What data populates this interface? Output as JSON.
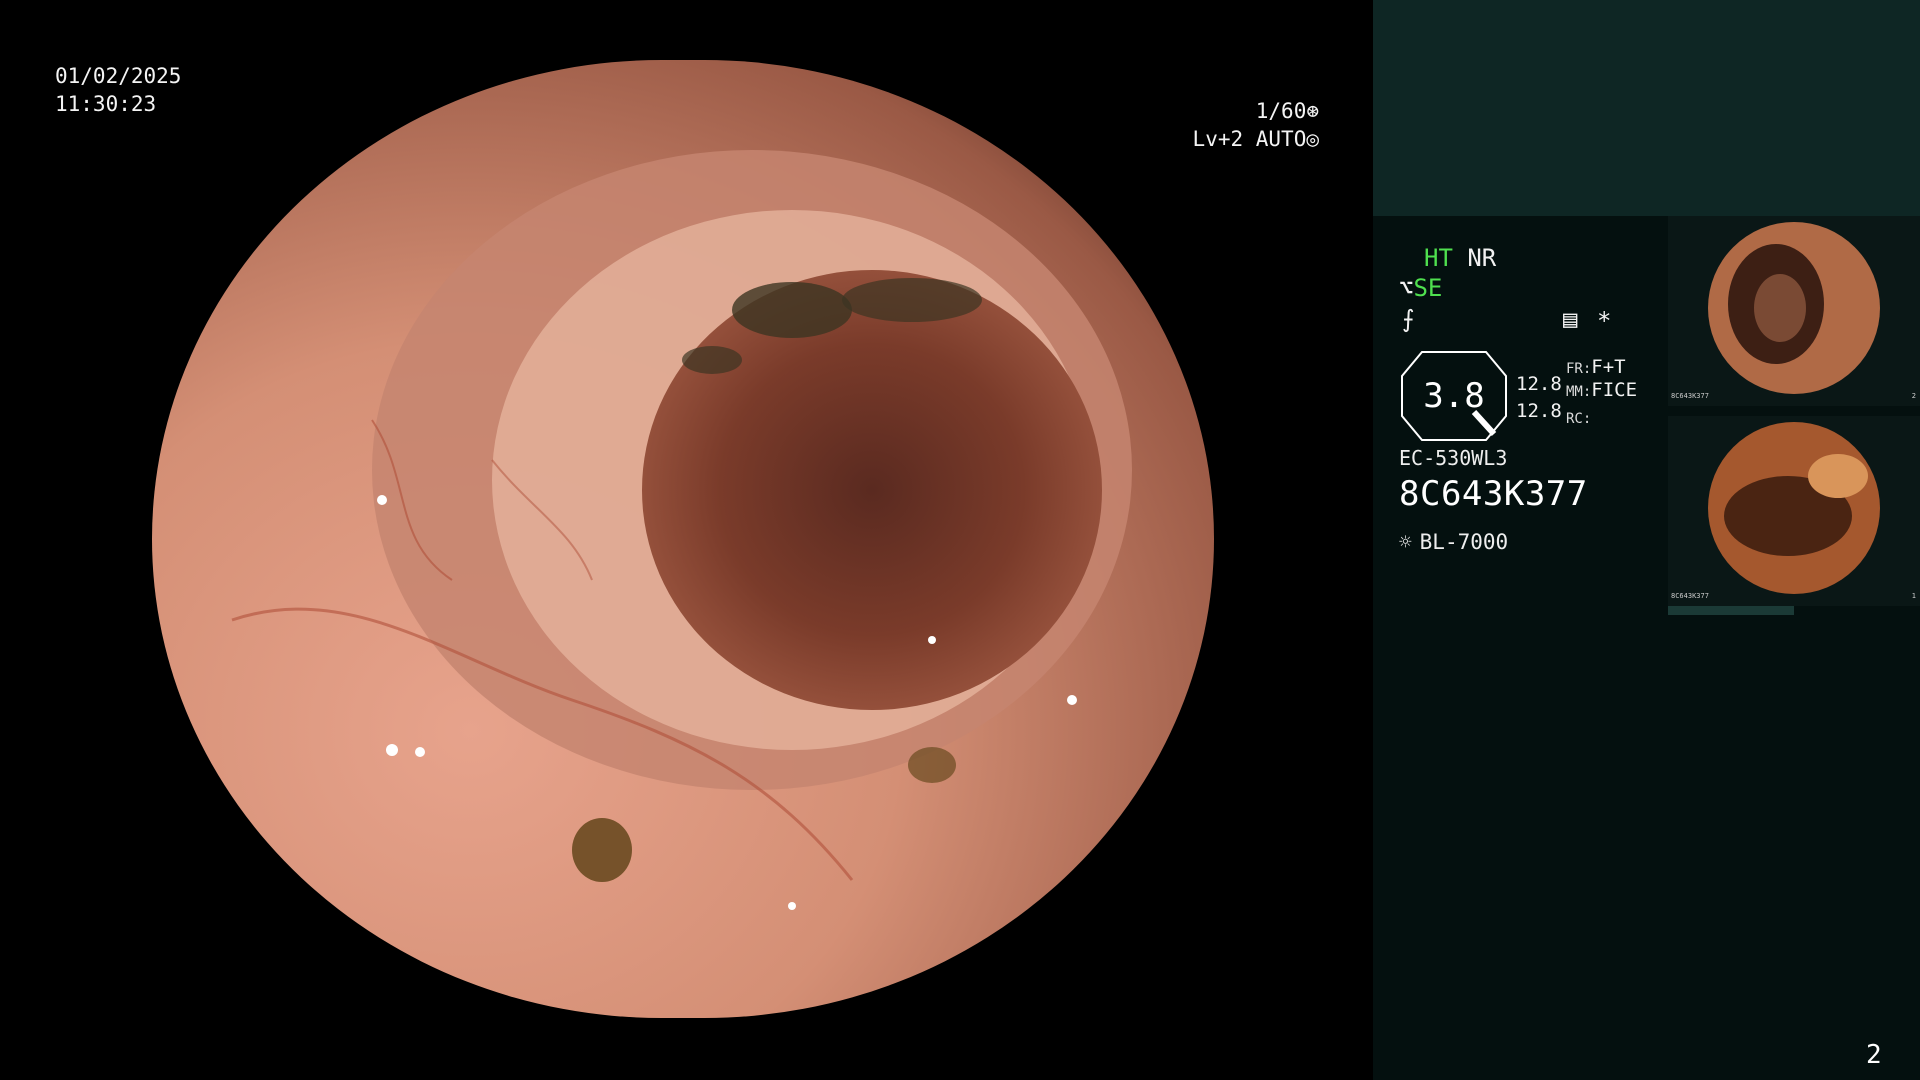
{
  "overlay": {
    "date": "01/02/2025",
    "time": "11:30:23",
    "shutter": "1/60",
    "shutter_icon": "aperture-icon",
    "exposure": "Lv+2 AUTO",
    "exposure_icon": "iris-icon"
  },
  "status": {
    "ht": "HT",
    "nr": "NR",
    "se": "SE",
    "se_icon": "structure-enhance-icon",
    "curve_icon": "tone-curve-icon",
    "menu_icon": "settings-panel-icon",
    "asterisk": "*",
    "zoom": "3.8",
    "val1": "12.8",
    "val2": "12.8",
    "fr_label": "FR:",
    "fr_value": "F+T",
    "mm_label": "MM:",
    "mm_value": "FICE",
    "rc_label": "RC:"
  },
  "device": {
    "model": "EC-530WL3",
    "serial": "8C643K377",
    "light_source": "BL-7000",
    "light_icon": "light-source-icon"
  },
  "thumbnails": [
    {
      "label": "8C643K377",
      "index": "2"
    },
    {
      "label": "8C643K377",
      "index": "1"
    }
  ],
  "page_number": "2",
  "colors": {
    "accent_green": "#4fe04f",
    "panel_bg": "#04100f",
    "panel_top_bg": "#0e2624"
  }
}
